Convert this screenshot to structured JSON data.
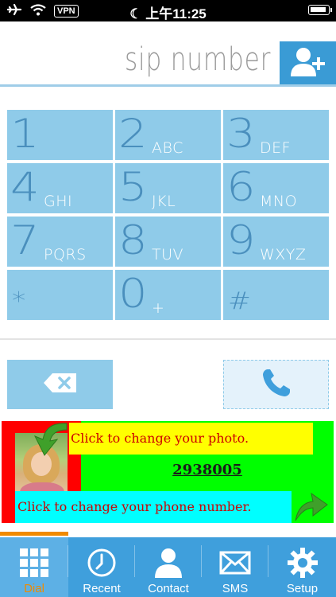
{
  "status_bar": {
    "vpn": "VPN",
    "time": "上午11:25"
  },
  "header": {
    "title": "sip number",
    "add_contact_icon": "add-user-icon"
  },
  "keypad": {
    "keys": [
      {
        "digit": "1",
        "letters": ""
      },
      {
        "digit": "2",
        "letters": "ABC"
      },
      {
        "digit": "3",
        "letters": "DEF"
      },
      {
        "digit": "4",
        "letters": "GHI"
      },
      {
        "digit": "5",
        "letters": "JKL"
      },
      {
        "digit": "6",
        "letters": "MNO"
      },
      {
        "digit": "7",
        "letters": "PQRS"
      },
      {
        "digit": "8",
        "letters": "TUV"
      },
      {
        "digit": "9",
        "letters": "WXYZ"
      },
      {
        "digit": "*",
        "letters": ""
      },
      {
        "digit": "0",
        "letters": "+"
      },
      {
        "digit": "#",
        "letters": ""
      }
    ]
  },
  "actions": {
    "backspace_icon": "backspace-icon",
    "call_icon": "phone-icon"
  },
  "banner": {
    "photo_text": "Click to change your photo.",
    "number": "2938005",
    "number_text": "Click to change your phone number."
  },
  "tabs": [
    {
      "label": "Dial",
      "icon": "keypad-grid-icon",
      "active": true
    },
    {
      "label": "Recent",
      "icon": "clock-icon",
      "active": false
    },
    {
      "label": "Contact",
      "icon": "person-icon",
      "active": false
    },
    {
      "label": "SMS",
      "icon": "envelope-icon",
      "active": false
    },
    {
      "label": "Setup",
      "icon": "gear-icon",
      "active": false
    }
  ],
  "colors": {
    "accent": "#3f9fdc",
    "key": "#8fcbe9",
    "active_tab_label": "#f08a00"
  }
}
